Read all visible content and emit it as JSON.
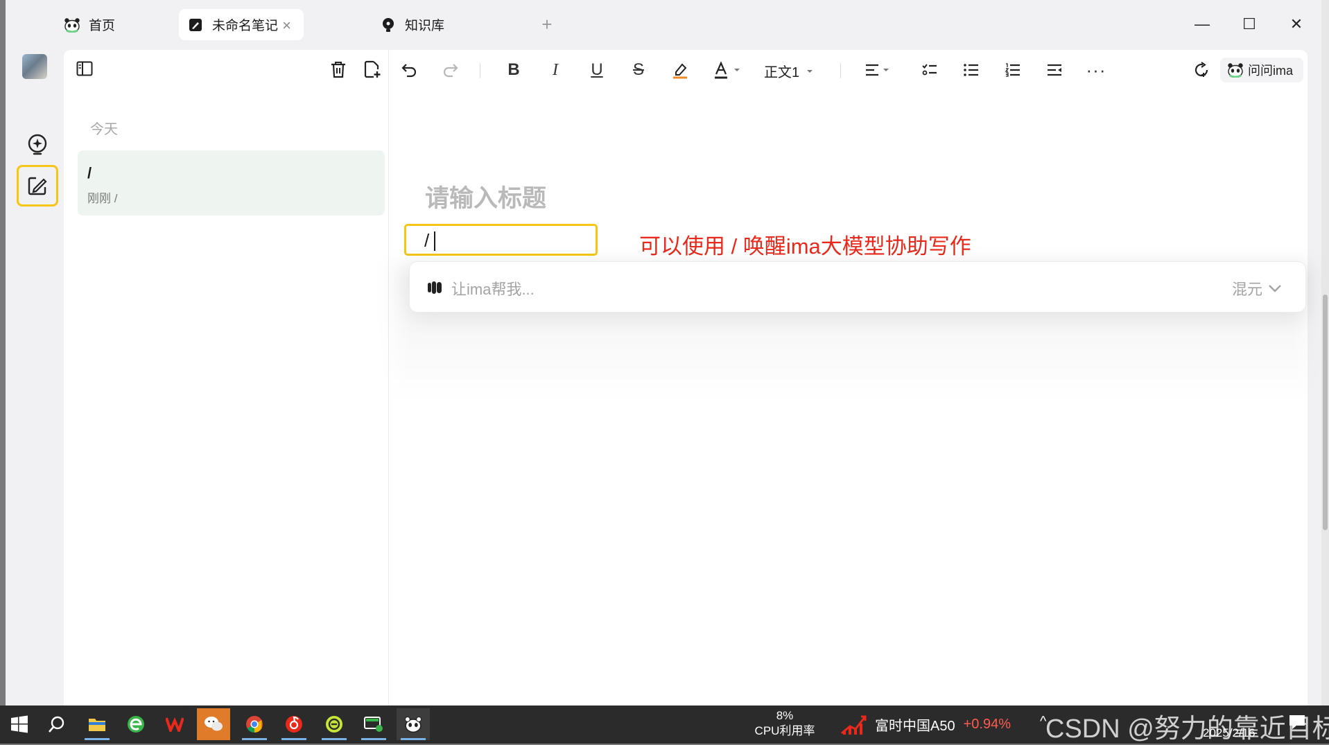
{
  "colors": {
    "accent_yellow": "#f5c518",
    "annotation_red": "#e8291c",
    "note_selected_bg": "#eef5f1",
    "placeholder_gray": "#b9b9b9"
  },
  "tabs": [
    {
      "label": "首页",
      "icon": "panda-icon"
    },
    {
      "label": "未命名笔记",
      "icon": "note-edit-icon",
      "active": true,
      "close": "×"
    },
    {
      "label": "知识库",
      "icon": "bulb-icon"
    }
  ],
  "new_tab": "+",
  "window_controls": {
    "minimize": "—",
    "maximize": "☐",
    "close": "✕"
  },
  "note_list": {
    "group_label": "今天",
    "items": [
      {
        "title": "/",
        "meta": "刚刚 /"
      }
    ]
  },
  "toolbar": {
    "style_label": "正文1",
    "ask_button": "问问ima"
  },
  "editor": {
    "title_placeholder": "请输入标题",
    "body_text": "/",
    "annotation": "可以使用 / 唤醒ima大模型协助写作",
    "ai_input_placeholder": "让ima帮我...",
    "model_name": "混元"
  },
  "taskbar": {
    "cpu_percent": "8%",
    "cpu_label": "CPU利用率",
    "stock_name": "富时中国A50",
    "stock_change": "+0.94%",
    "date": "2025/2/16",
    "watermark": "CSDN @努力的靠近目标"
  }
}
